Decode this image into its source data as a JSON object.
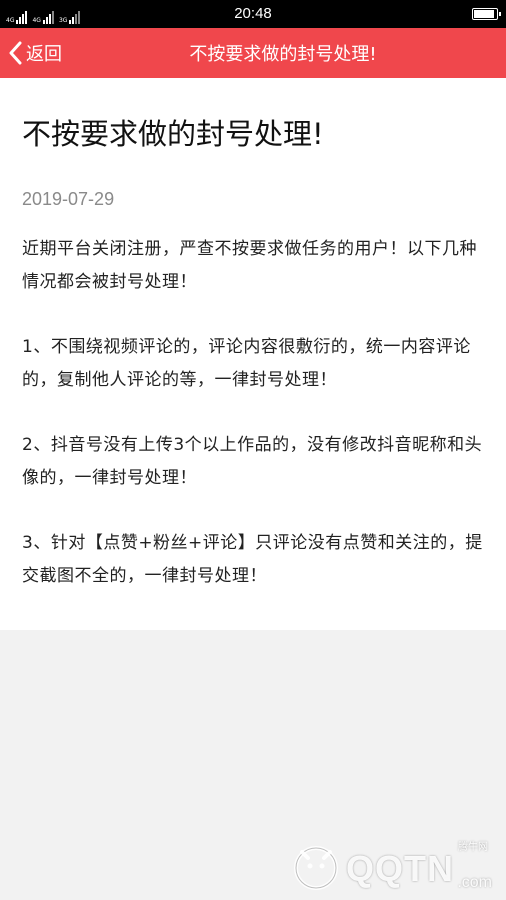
{
  "status_bar": {
    "network_1": "4G",
    "network_2": "4G",
    "network_3": "3G",
    "time": "20:48",
    "battery_icon": "battery-icon"
  },
  "nav": {
    "back_label": "返回",
    "title": "不按要求做的封号处理!",
    "background_color": "#f0474c"
  },
  "article": {
    "title": "不按要求做的封号处理!",
    "date": "2019-07-29",
    "paragraphs": [
      "近期平台关闭注册，严查不按要求做任务的用户！以下几种情况都会被封号处理！",
      "1、不围绕视频评论的，评论内容很敷衍的，统一内容评论的，复制他人评论的等，一律封号处理！",
      "2、抖音号没有上传3个以上作品的，没有修改抖音昵称和头像的，一律封号处理！",
      "3、针对【点赞+粉丝+评论】只评论没有点赞和关注的，提交截图不全的，一律封号处理！"
    ]
  },
  "watermark": {
    "brand_small": "腾牛网",
    "brand": "QQTN",
    "suffix": ".com"
  }
}
